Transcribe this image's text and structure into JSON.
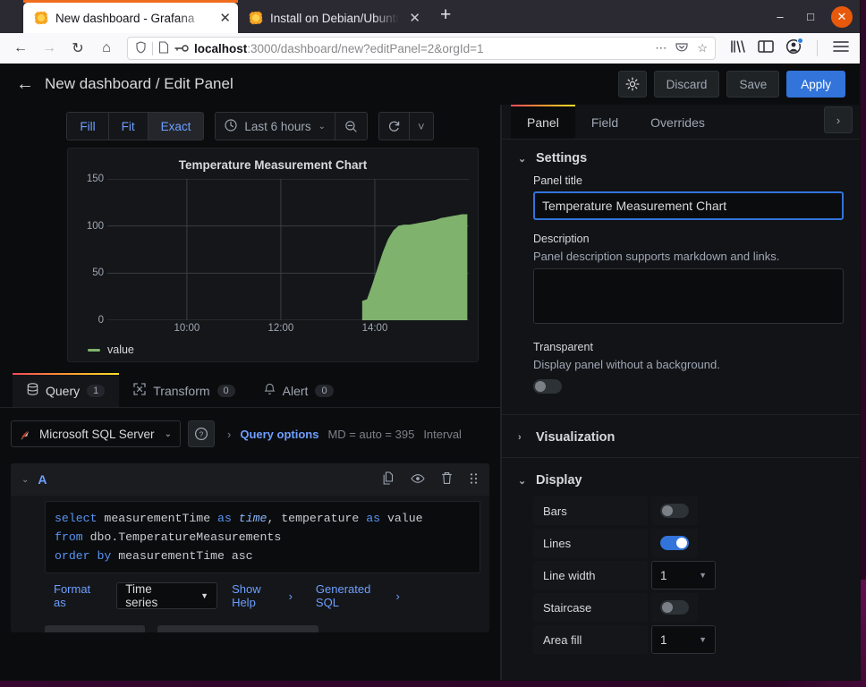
{
  "browser": {
    "tabs": [
      {
        "title": "New dashboard - Grafana",
        "favicon": "grafana-icon",
        "active": true
      },
      {
        "title": "Install on Debian/Ubuntu",
        "favicon": "grafana-icon",
        "active": false
      }
    ],
    "new_tab_label": "+",
    "window_controls": {
      "minimize": "–",
      "maximize": "□",
      "close": "✕"
    },
    "nav": {
      "back": "←",
      "forward": "→",
      "reload": "↻",
      "home": "⌂"
    },
    "url": {
      "host": "localhost",
      "rest": ":3000/dashboard/new?editPanel=2&orgId=1"
    },
    "url_icons": {
      "shield": "shield-icon",
      "page": "page-icon",
      "permissions": "key-icon",
      "more": "⋯",
      "pocket": "pocket-icon",
      "bookmark": "☆"
    },
    "toolbar_icons": {
      "library": "library-icon",
      "sidebar": "sidebar-icon",
      "account": "account-icon",
      "menu": "hamburger-menu-icon"
    }
  },
  "grafana": {
    "header": {
      "back_label": "←",
      "breadcrumb": "New dashboard / Edit Panel",
      "settings_icon": "gear-icon",
      "discard_label": "Discard",
      "save_label": "Save",
      "apply_label": "Apply"
    },
    "viz_toolbar": {
      "fit_modes": [
        {
          "label": "Fill",
          "selected": false
        },
        {
          "label": "Fit",
          "selected": false
        },
        {
          "label": "Exact",
          "selected": true
        }
      ],
      "time_range": "Last 6 hours",
      "clock_icon": "clock-icon",
      "zoom_out_icon": "zoom-out-icon",
      "refresh_icon": "refresh-icon",
      "refresh_caret": "˅"
    },
    "query_tabs": [
      {
        "label": "Query",
        "count": "1",
        "icon": "database-icon",
        "active": true
      },
      {
        "label": "Transform",
        "count": "0",
        "icon": "transform-icon",
        "active": false
      },
      {
        "label": "Alert",
        "count": "0",
        "icon": "bell-icon",
        "active": false
      }
    ],
    "datasource": {
      "name": "Microsoft SQL Server",
      "icon": "mssql-icon",
      "help_icon": "question-circle-icon",
      "query_options_label": "Query options",
      "query_options_meta": "MD = auto = 395",
      "query_options_interval": "Interval"
    },
    "query": {
      "ref_id": "A",
      "collapse_icon": "chevron-down-icon",
      "actions": {
        "copy": "copy-icon",
        "hide": "eye-icon",
        "delete": "trash-icon",
        "drag": "drag-handle-icon"
      },
      "sql_lines": [
        [
          {
            "t": "select ",
            "c": "kw"
          },
          {
            "t": "measurementTime ",
            "c": ""
          },
          {
            "t": "as ",
            "c": "kw"
          },
          {
            "t": "time",
            "c": "ital"
          },
          {
            "t": ", temperature ",
            "c": ""
          },
          {
            "t": "as ",
            "c": "kw"
          },
          {
            "t": "value",
            "c": ""
          }
        ],
        [
          {
            "t": "from ",
            "c": "kw"
          },
          {
            "t": "dbo.TemperatureMeasurements",
            "c": ""
          }
        ],
        [
          {
            "t": "order ",
            "c": "kw"
          },
          {
            "t": "by ",
            "c": "kw"
          },
          {
            "t": "measurementTime ",
            "c": ""
          },
          {
            "t": "asc",
            "c": ""
          }
        ]
      ],
      "format_as_label": "Format as",
      "format_value": "Time series",
      "show_help_label": "Show Help",
      "generated_sql_label": "Generated SQL",
      "chevron": "›"
    },
    "options": {
      "tabs": [
        {
          "label": "Panel",
          "active": true
        },
        {
          "label": "Field",
          "active": false
        },
        {
          "label": "Overrides",
          "active": false
        }
      ],
      "expand_icon": "›",
      "settings": {
        "header": "Settings",
        "panel_title_label": "Panel title",
        "panel_title_value": "Temperature Measurement Chart",
        "description_label": "Description",
        "description_help": "Panel description supports markdown and links.",
        "description_value": "",
        "transparent_label": "Transparent",
        "transparent_help": "Display panel without a background.",
        "transparent_on": false
      },
      "visualization_header": "Visualization",
      "display": {
        "header": "Display",
        "rows": [
          {
            "label": "Bars",
            "type": "toggle",
            "on": false
          },
          {
            "label": "Lines",
            "type": "toggle",
            "on": true
          },
          {
            "label": "Line width",
            "type": "select",
            "value": "1"
          },
          {
            "label": "Staircase",
            "type": "toggle",
            "on": false
          },
          {
            "label": "Area fill",
            "type": "select",
            "value": "1"
          }
        ]
      }
    }
  },
  "chart_data": {
    "type": "area",
    "title": "Temperature Measurement Chart",
    "xlabel": "",
    "ylabel": "",
    "ylim": [
      0,
      150
    ],
    "yticks": [
      0,
      50,
      100,
      150
    ],
    "xticks": [
      "10:00",
      "12:00",
      "14:00"
    ],
    "grid": true,
    "legend": [
      "value"
    ],
    "legend_position": "bottom-left",
    "series": [
      {
        "name": "value",
        "color": "#7eb26d",
        "x": [
          "13:38",
          "13:40",
          "13:42",
          "13:44",
          "13:46",
          "13:48",
          "13:50",
          "13:52",
          "13:54",
          "13:56",
          "13:58",
          "14:00",
          "14:05",
          "14:10",
          "14:15",
          "14:20",
          "14:25",
          "14:30",
          "14:35",
          "14:40",
          "14:45"
        ],
        "values": [
          20,
          22,
          38,
          55,
          72,
          86,
          95,
          100,
          101,
          101,
          102,
          103,
          104,
          105,
          106,
          108,
          109,
          110,
          111,
          112,
          112
        ]
      }
    ]
  }
}
